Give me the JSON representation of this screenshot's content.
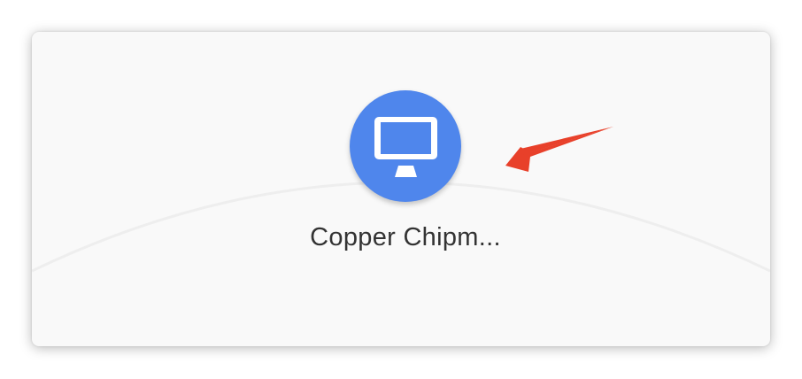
{
  "device": {
    "name": "Copper Chipm...",
    "icon": "monitor-icon",
    "color": "#4f86ec"
  },
  "annotation": {
    "type": "arrow",
    "color": "#e8402a"
  }
}
